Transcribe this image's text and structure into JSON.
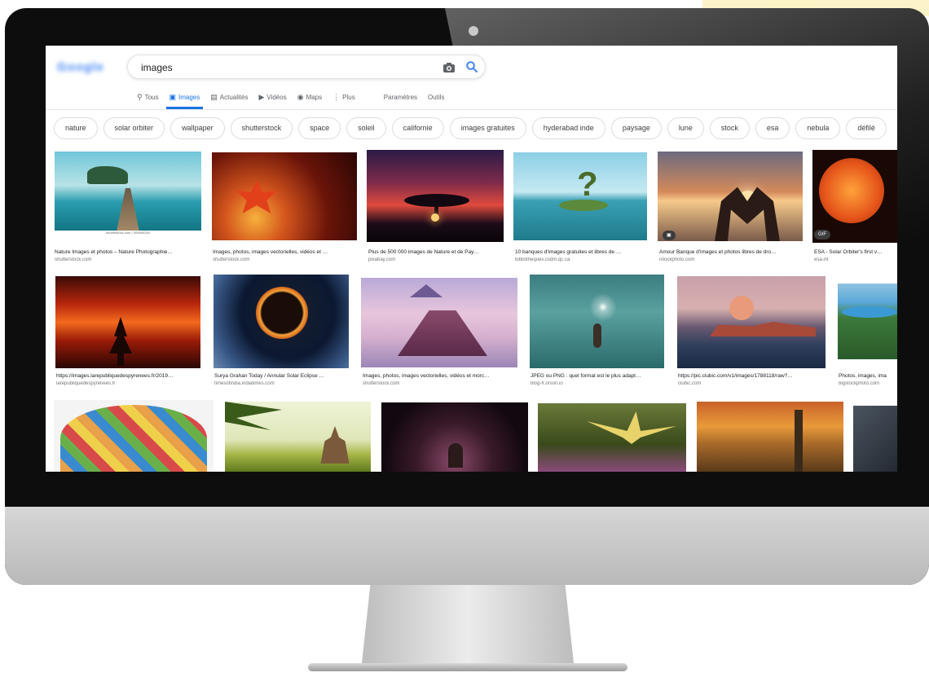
{
  "search": {
    "query": "images"
  },
  "logo": {
    "text": "Google"
  },
  "tabs": [
    {
      "label": "Tous",
      "icon": "search-icon"
    },
    {
      "label": "Images",
      "icon": "image-icon"
    },
    {
      "label": "Actualités",
      "icon": "news-icon"
    },
    {
      "label": "Vidéos",
      "icon": "video-icon"
    },
    {
      "label": "Maps",
      "icon": "map-pin-icon"
    },
    {
      "label": "Plus",
      "icon": "more-icon"
    },
    {
      "label": "Paramètres"
    },
    {
      "label": "Outils"
    }
  ],
  "chips": [
    "nature",
    "solar orbiter",
    "wallpaper",
    "shutterstock",
    "space",
    "soleil",
    "californie",
    "images gratuites",
    "hyderabad inde",
    "paysage",
    "lune",
    "stock",
    "esa",
    "nebula",
    "défilé"
  ],
  "results_row1": [
    {
      "title": "Nature Images et photos – Nature Photographie…",
      "source": "shutterstock.com"
    },
    {
      "title": "Images, photos, images vectorielles, vidéos et …",
      "source": "shutterstock.com"
    },
    {
      "title": "Plus de 500 000 images de Nature et de Pay…",
      "source": "pixabay.com"
    },
    {
      "title": "10 banques d'images gratuites et libres de …",
      "source": "bibliotheques.csdm.qc.ca"
    },
    {
      "title": "Amour Banque d'images et photos libres de dro…",
      "source": "istockphoto.com"
    },
    {
      "title": "ESA - Solar Orbiter's first v…",
      "source": "esa.int"
    }
  ],
  "results_row2": [
    {
      "title": "https://images.larepubliquedespyrenees.fr/2019…",
      "source": "larepubliquedespyrenees.fr"
    },
    {
      "title": "Surya Grahan Today / Annular Solar Eclipse …",
      "source": "timesofindia.indiatimes.com"
    },
    {
      "title": "Images, photos, images vectorielles, vidéos et morc…",
      "source": "shutterstock.com"
    },
    {
      "title": "JPEG ou PNG : quel format est le plus adapt…",
      "source": "blog-fr.orson.io"
    },
    {
      "title": "https://pic.clubic.com/v1/images/1788118/raw?…",
      "source": "clubic.com"
    },
    {
      "title": "Photos, images, ima",
      "source": "bigstockphoto.com"
    }
  ],
  "badges": {
    "gif": "GIF"
  },
  "watermark": "shutterstock.com • 308949260"
}
